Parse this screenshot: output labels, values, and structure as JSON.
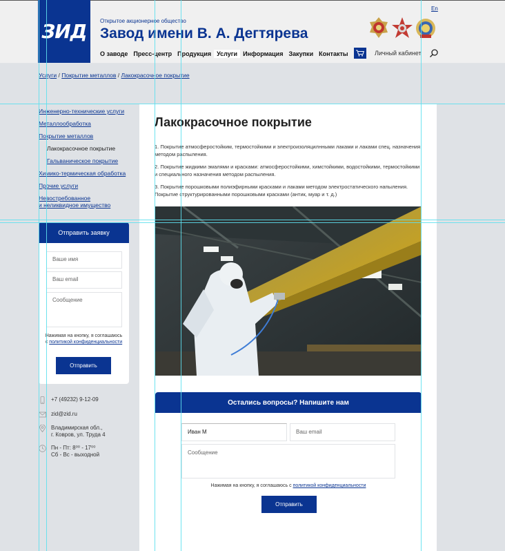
{
  "header": {
    "logo_text": "ЗИД",
    "org_subtitle": "Открытое акционерное общество",
    "org_title": "Завод имени В. А. Дегтярева",
    "lang": "En",
    "cabinet": "Личный кабинет",
    "nav": [
      "О заводе",
      "Пресс-центр",
      "Продукция",
      "Услуги",
      "Информация",
      "Закупки",
      "Контакты"
    ],
    "active_nav": "Услуги"
  },
  "breadcrumb": {
    "items": [
      "Услуги",
      "Покрытие металлов",
      "Лакокрасочное покрытие"
    ],
    "separator": " / "
  },
  "sidebar": {
    "items": [
      "Инженерно-технические услуги",
      "Металлообработка",
      "Покрытие металлов",
      "Лакокрасочное покрытие",
      "Гальваническое покрытие",
      "Химико-термическая обработка",
      "Прочие услуги",
      "Невостребованное",
      "и неликвидное имущество"
    ]
  },
  "request_form": {
    "title": "Отправить заявку",
    "name_placeholder": "Ваше имя",
    "email_placeholder": "Ваш email",
    "message_placeholder": "Сообщение",
    "note_prefix": "Нажимая на кнопку, я соглашаюсь с",
    "note_link": "политикой конфиденциальности",
    "submit": "Отправить"
  },
  "contacts": {
    "phone": "+7 (49232) 9-12-09",
    "email": "zid@zid.ru",
    "address_1": "Владимирская обл.,",
    "address_2": "г. Ковров, ул. Труда 4",
    "hours_1": "Пн - Пт: 8⁰⁰ - 17⁰⁰",
    "hours_2": "Сб - Вс - выходной"
  },
  "main": {
    "title": "Лакокрасочное покрытие",
    "paragraphs": [
      "1. Покрытие атмосферостойким, термостойкими и электроизоляцилнными лаками и лаками спец. назначения методом распыления.",
      "2.  Покрытие жидкими эмалями и красками: атмосферостойкими, химстойкими, водостойкими, термостойкими и специального назначения методом распыления.",
      "3. Покрытие порошковыми полиэфирными красками и лаками методом электростатического напыления. Покрытие структурированными порошковыми красками (антик, муар и т. д.)"
    ]
  },
  "feedback": {
    "title": "Остались вопросы? Напишите нам",
    "name_value": "Иван М",
    "email_placeholder": "Ваш email",
    "message_placeholder": "Сообщение",
    "note_prefix": "Нажимая на кнопку, я соглашаюсь с",
    "note_link": "политикой конфиденциальности",
    "submit": "Отправить"
  },
  "colors": {
    "brand": "#0a3491",
    "guides": "#5ee0ee",
    "page_bg": "#dfe2e6"
  }
}
